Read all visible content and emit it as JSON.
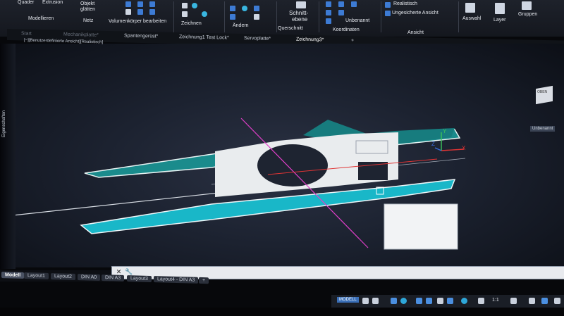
{
  "ribbon": {
    "labels": {
      "quader": "Quader",
      "extrusion": "Extrusion",
      "objekt": "Objekt",
      "glaetten": "glätten",
      "modellieren": "Modellieren",
      "netz": "Netz",
      "volumenkoerper": "Volumenkörper bearbeiten",
      "zeichnen": "Zeichnen",
      "aendern": "Ändern",
      "schnittebene_1": "Schnitt-",
      "schnittebene_2": "ebene",
      "querschnitt": "Querschnitt",
      "unbenannt": "Unbenannt",
      "koordinaten": "Koordinaten",
      "realistisch": "Realistisch",
      "ungesichert": "Ungesicherte Ansicht",
      "ansicht": "Ansicht",
      "auswahl": "Auswahl",
      "layer": "Layer",
      "gruppen": "Gruppen"
    }
  },
  "file_tabs": [
    {
      "label": "Start",
      "state": "dim"
    },
    {
      "label": "Mechanikplatte*",
      "state": "dim"
    },
    {
      "label": "Spantengerüst*",
      "state": "normal"
    },
    {
      "label": "Zeichnung1 Test Lock*",
      "state": "normal"
    },
    {
      "label": "Servoplatte*",
      "state": "normal"
    },
    {
      "label": "Zeichnung3*",
      "state": "active"
    },
    {
      "label": "+",
      "state": "normal"
    }
  ],
  "viewport": {
    "label": "[−][Benutzerdefinierte Ansicht][Realistisch]",
    "side_palette_label": "Eigenschaften",
    "viewcube_label": "OBEN",
    "view_button": "Unbenannt",
    "axes": {
      "x": "X",
      "y": "Y",
      "z": "Z"
    }
  },
  "layout_tabs": [
    {
      "label": "Modell",
      "active": true
    },
    {
      "label": "Layout1",
      "active": false
    },
    {
      "label": "Layout2",
      "active": false
    },
    {
      "label": "DIN A0",
      "active": false
    },
    {
      "label": "DIN A3",
      "active": false
    },
    {
      "label": "Layout3",
      "active": false
    },
    {
      "label": "Layout4 - DIN A3",
      "active": false
    },
    {
      "label": "+",
      "active": false
    }
  ],
  "statusbar": {
    "model_button": "MODELL",
    "scale": "1:1"
  },
  "colors": {
    "model_cyan": "#19b7c8",
    "model_teal": "#1a8b8c",
    "model_plate": "#e9ecee",
    "crosshair_magenta": "#e03fc9",
    "axis_red": "#e03434",
    "axis_green": "#3cc45a",
    "axis_blue": "#3a6ee0"
  }
}
